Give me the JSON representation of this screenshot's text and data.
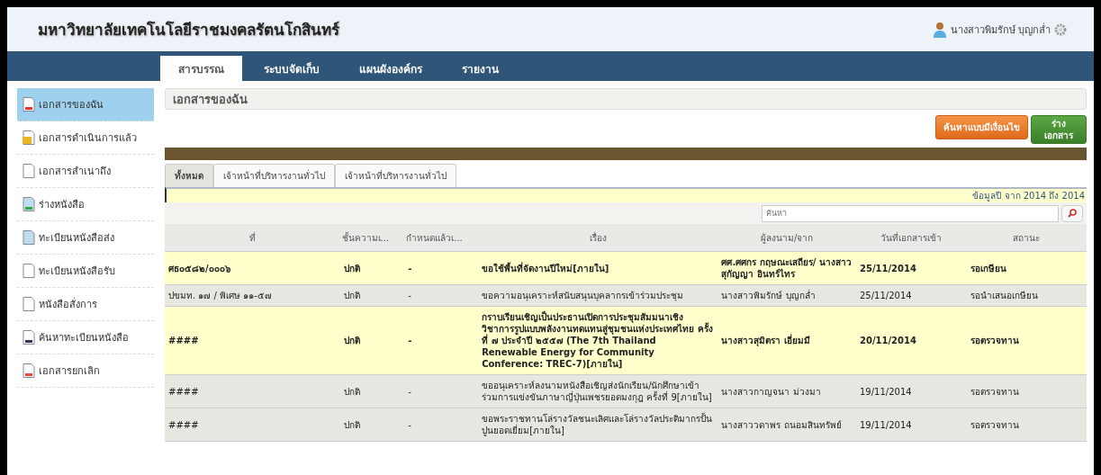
{
  "header": {
    "title": "มหาวิทยาลัยเทคโนโลยีราชมงคลรัตนโกสินทร์",
    "user": "นางสาวพิมรักษ์ บุญกล่ำ"
  },
  "nav_tabs": [
    {
      "label": "สารบรรณ",
      "selected": true
    },
    {
      "label": "ระบบจัดเก็บ",
      "selected": false
    },
    {
      "label": "แผนผังองค์กร",
      "selected": false
    },
    {
      "label": "รายงาน",
      "selected": false
    }
  ],
  "sidebar": {
    "items": [
      {
        "label": "เอกสารของฉัน",
        "selected": true
      },
      {
        "label": "เอกสารดำเนินการแล้ว",
        "selected": false
      },
      {
        "label": "เอกสารสำเนาถึง",
        "selected": false
      },
      {
        "label": "ร่างหนังสือ",
        "selected": false
      },
      {
        "label": "ทะเบียนหนังสือส่ง",
        "selected": false
      },
      {
        "label": "ทะเบียนหนังสือรับ",
        "selected": false
      },
      {
        "label": "หนังสือสั่งการ",
        "selected": false
      },
      {
        "label": "ค้นหาทะเบียนหนังสือ",
        "selected": false
      },
      {
        "label": "เอกสารยกเลิก",
        "selected": false
      }
    ]
  },
  "page_title": "เอกสารของฉัน",
  "buttons": [
    {
      "label": "ค้นหาแบบมีเงื่อนไข",
      "kind": "orange"
    },
    {
      "label": "ร่าง เอกสาร",
      "kind": "green"
    }
  ],
  "filter_tabs": [
    {
      "label": "ทั้งหมด",
      "selected": true
    },
    {
      "label": "เจ้าหน้าที่บริหารงานทั่วไป",
      "selected": false
    },
    {
      "label": "เจ้าหน้าที่บริหารงานทั่วไป",
      "selected": false
    }
  ],
  "year_info": "ข้อมูลปี จาก 2014 ถึง 2014",
  "search": {
    "placeholder": "ค้นหา"
  },
  "table": {
    "columns": [
      "ที่",
      "ชั้นความเ...",
      "กำหนดแล้วเ...",
      "เรื่อง",
      "ผู้ลงนาม/จาก",
      "วันที่เอกสารเข้า",
      "สถานะ"
    ],
    "rows": [
      {
        "unread": true,
        "cells": [
          "ศธ๐๕๘๒/๐๐๐๖",
          "ปกติ",
          "-",
          "ขอใช้พื้นที่จัดงานปีใหม่[ภายใน]",
          "ศศ.ศศกร กฤษณะเสถียร/ นางสาวสุกัญญา อินทร์ไทร",
          "25/11/2014",
          "รอเกษียน"
        ]
      },
      {
        "unread": false,
        "cells": [
          "ปขมท. ๑๗ / พิเศษ ๑๑-๕๗",
          "ปกติ",
          "-",
          "ขอความอนุเคราะห์สนับสนุนบุคลากรเข้าร่วมประชุม",
          "นางสาวพิมรักษ์ บุญกล่ำ",
          "25/11/2014",
          "รอนำเสนอเกษียน"
        ]
      },
      {
        "unread": true,
        "cells": [
          "####",
          "ปกติ",
          "-",
          "กราบเรียนเชิญเป็นประธานเปิดการประชุมสัมมนาเชิงวิชาการรูปแบบพลังงานทดแทนสู่ชุมชนแห่งประเทศไทย ครั้งที่ ๗ ประจำปี ๒๕๕๗ (The 7th Thailand Renewable Energy for Community Conference: TREC-7)[ภายใน]",
          "นางสาวสุมิตรา เอี่ยมมี",
          "20/11/2014",
          "รอตรวจทาน"
        ]
      },
      {
        "unread": false,
        "cells": [
          "####",
          "ปกติ",
          "-",
          "ขออนุเคราะห์ลงนามหนังสือเชิญส่งนักเรียน/นักศึกษาเข้าร่วมการแข่งขันภาษาญี่ปุ่นเพชรยอดมงกุฎ ครั้งที่ 9[ภายใน]",
          "นางสาวกาญจนา ม่วงมา",
          "19/11/2014",
          "รอตรวจทาน"
        ]
      },
      {
        "unread": false,
        "cells": [
          "####",
          "ปกติ",
          "-",
          "ขอพระราชทานโล่รางวัลชนะเลิศและโล่รางวัลประติมากรปั้นปูนยอดเยี่ยม[ภายใน]",
          "นางสาววดาพร ถนอมสินทรัพย์",
          "19/11/2014",
          "รอตรวจทาน"
        ]
      }
    ]
  }
}
